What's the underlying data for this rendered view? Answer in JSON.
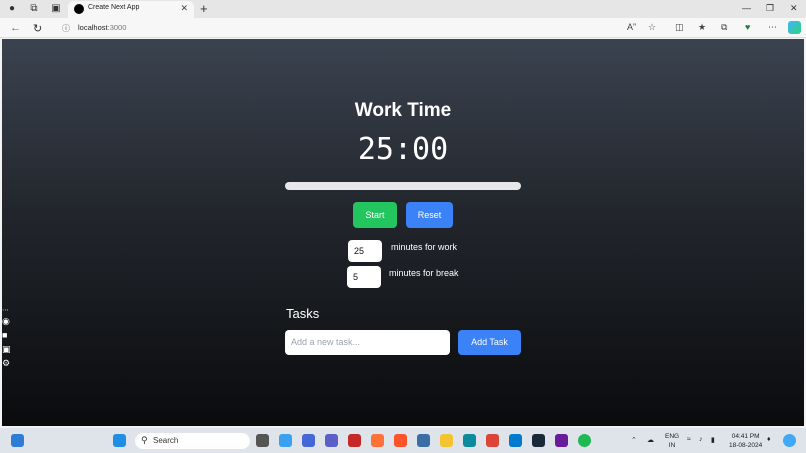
{
  "browser": {
    "tab_title": "Create Next App",
    "url_host": "localhost",
    "url_port": ":3000"
  },
  "timer": {
    "title": "Work Time",
    "display": "25:00",
    "progress_fraction": 0.0
  },
  "controls": {
    "start_label": "Start",
    "reset_label": "Reset"
  },
  "settings": {
    "work_minutes": "25",
    "work_label": "minutes for work",
    "break_minutes": "5",
    "break_label": "minutes for break"
  },
  "tasks": {
    "heading": "Tasks",
    "input_placeholder": "Add a new task...",
    "add_label": "Add Task"
  },
  "taskbar": {
    "search_placeholder": "Search",
    "lang_line1": "ENG",
    "lang_line2": "IN",
    "time": "04:41 PM",
    "date": "18-08-2024"
  }
}
